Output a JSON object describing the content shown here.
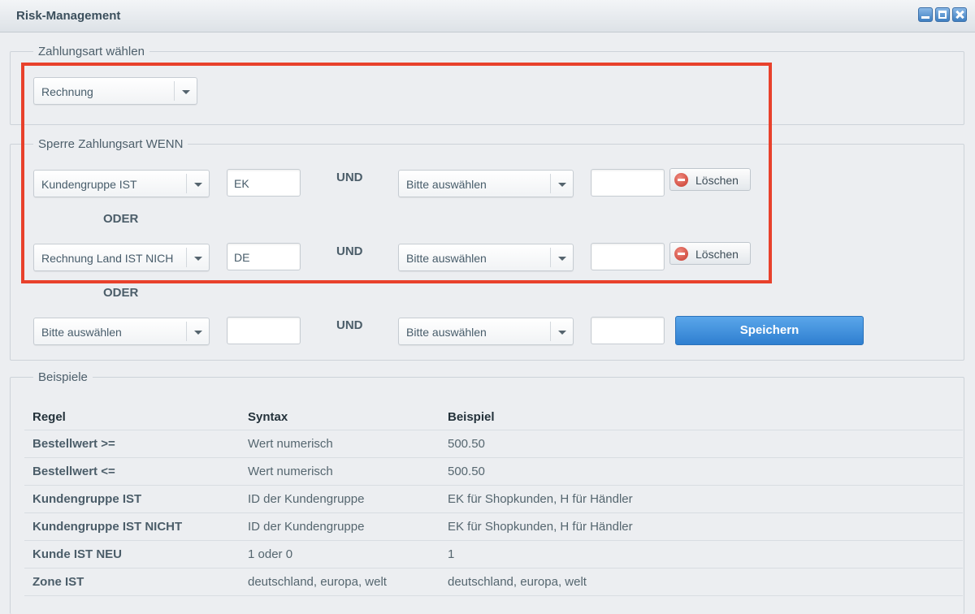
{
  "window": {
    "title": "Risk-Management"
  },
  "payment_section": {
    "legend": "Zahlungsart wählen",
    "selected": "Rechnung"
  },
  "block_section": {
    "legend": "Sperre Zahlungsart WENN",
    "and_label": "UND",
    "or_label": "ODER",
    "delete_label": "Löschen",
    "save_label": "Speichern",
    "rules": [
      {
        "condition1": "Kundengruppe IST",
        "value1": "EK",
        "condition2": "Bitte auswählen",
        "value2": ""
      },
      {
        "condition1": "Rechnung Land IST NICH",
        "value1": "DE",
        "condition2": "Bitte auswählen",
        "value2": ""
      },
      {
        "condition1": "Bitte auswählen",
        "value1": "",
        "condition2": "Bitte auswählen",
        "value2": ""
      }
    ]
  },
  "examples": {
    "legend": "Beispiele",
    "headers": [
      "Regel",
      "Syntax",
      "Beispiel"
    ],
    "rows": [
      [
        "Bestellwert >=",
        "Wert numerisch",
        "500.50"
      ],
      [
        "Bestellwert <=",
        "Wert numerisch",
        "500.50"
      ],
      [
        "Kundengruppe IST",
        "ID der Kundengruppe",
        "EK für Shopkunden, H für Händler"
      ],
      [
        "Kundengruppe IST NICHT",
        "ID der Kundengruppe",
        "EK für Shopkunden, H für Händler"
      ],
      [
        "Kunde IST NEU",
        "1 oder 0",
        "1"
      ],
      [
        "Zone IST",
        "deutschland, europa, welt",
        "deutschland, europa, welt"
      ]
    ]
  },
  "colors": {
    "highlight": "#e8412c",
    "save_button": "#3b8fdc",
    "delete_icon": "#d9493b"
  }
}
